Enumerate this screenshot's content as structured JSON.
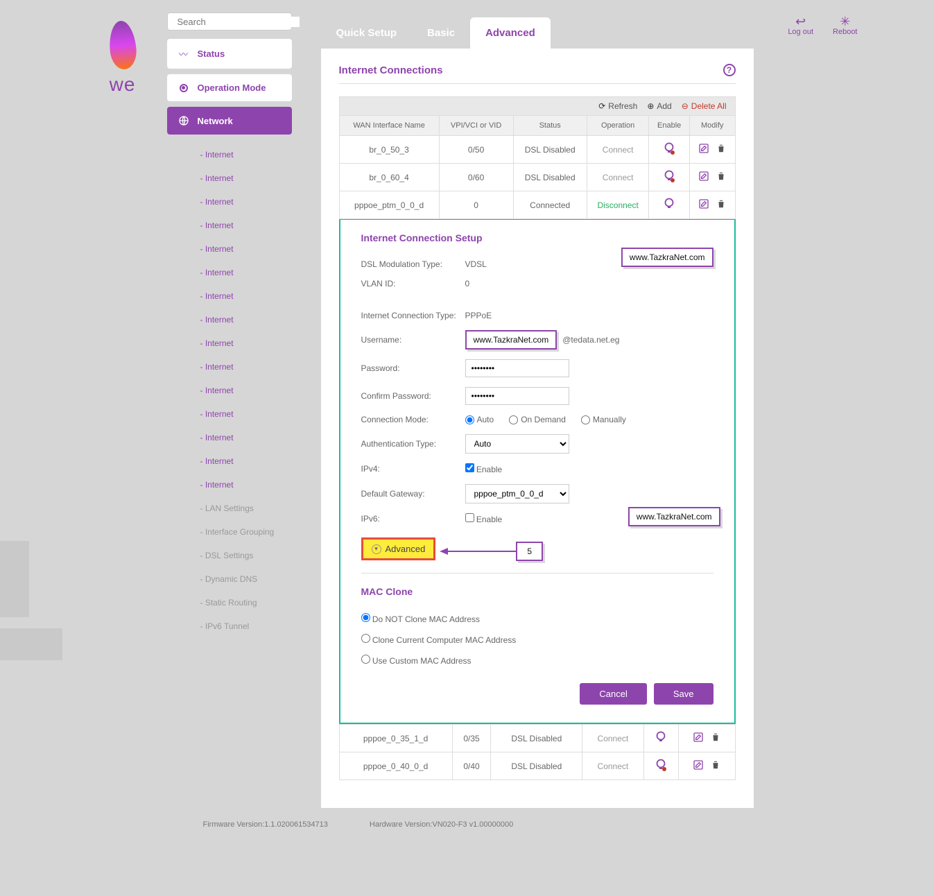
{
  "brand": "we",
  "search_placeholder": "Search",
  "tabs": {
    "quick": "Quick Setup",
    "basic": "Basic",
    "advanced": "Advanced"
  },
  "top_actions": {
    "logout": "Log out",
    "reboot": "Reboot"
  },
  "sidebar": {
    "status": "Status",
    "operation_mode": "Operation Mode",
    "network": "Network",
    "sub_internet": "- Internet",
    "lan": "- LAN Settings",
    "ig": "- Interface Grouping",
    "dsl": "- DSL Settings",
    "ddns": "- Dynamic DNS",
    "sroute": "- Static Routing",
    "ipv6t": "- IPv6 Tunnel"
  },
  "panel": {
    "title": "Internet Connections",
    "bar": {
      "refresh": "Refresh",
      "add": "Add",
      "delete": "Delete All"
    },
    "th": {
      "name": "WAN Interface Name",
      "vpi": "VPI/VCI or VID",
      "status": "Status",
      "op": "Operation",
      "enable": "Enable",
      "modify": "Modify"
    },
    "rows": [
      {
        "name": "br_0_50_3",
        "vpi": "0/50",
        "status": "DSL Disabled",
        "op": "Connect",
        "opcls": "",
        "bulb": "off"
      },
      {
        "name": "br_0_60_4",
        "vpi": "0/60",
        "status": "DSL Disabled",
        "op": "Connect",
        "opcls": "",
        "bulb": "off"
      },
      {
        "name": "pppoe_ptm_0_0_d",
        "vpi": "0",
        "status": "Connected",
        "op": "Disconnect",
        "opcls": "disc",
        "bulb": "on"
      }
    ],
    "rows2": [
      {
        "name": "pppoe_0_35_1_d",
        "vpi": "0/35",
        "status": "DSL Disabled",
        "op": "Connect",
        "bulb": "on"
      },
      {
        "name": "pppoe_0_40_0_d",
        "vpi": "0/40",
        "status": "DSL Disabled",
        "op": "Connect",
        "bulb": "off"
      }
    ]
  },
  "setup": {
    "title": "Internet Connection Setup",
    "dsl_mod_lbl": "DSL Modulation Type:",
    "dsl_mod_val": "VDSL",
    "vlan_lbl": "VLAN ID:",
    "vlan_val": "0",
    "ict_lbl": "Internet Connection Type:",
    "ict_val": "PPPoE",
    "user_lbl": "Username:",
    "user_suffix": "@tedata.net.eg",
    "pass_lbl": "Password:",
    "pass_val": "••••••••",
    "cpass_lbl": "Confirm Password:",
    "cpass_val": "••••••••",
    "cmode_lbl": "Connection Mode:",
    "cmode_auto": "Auto",
    "cmode_dem": "On Demand",
    "cmode_man": "Manually",
    "auth_lbl": "Authentication Type:",
    "auth_val": "Auto",
    "ipv4_lbl": "IPv4:",
    "enable_lbl": "Enable",
    "gw_lbl": "Default Gateway:",
    "gw_val": "pppoe_ptm_0_0_d",
    "ipv6_lbl": "IPv6:",
    "adv_toggle": "Advanced",
    "mac_title": "MAC Clone",
    "mac_opt1": "Do NOT Clone MAC Address",
    "mac_opt2": "Clone Current Computer MAC Address",
    "mac_opt3": "Use Custom MAC Address",
    "cancel": "Cancel",
    "save": "Save"
  },
  "watermark": "www.TazkraNet.com",
  "ann_num": "5",
  "footer": {
    "fw": "Firmware Version:1.1.020061534713",
    "hw": "Hardware Version:VN020-F3 v1.00000000"
  }
}
